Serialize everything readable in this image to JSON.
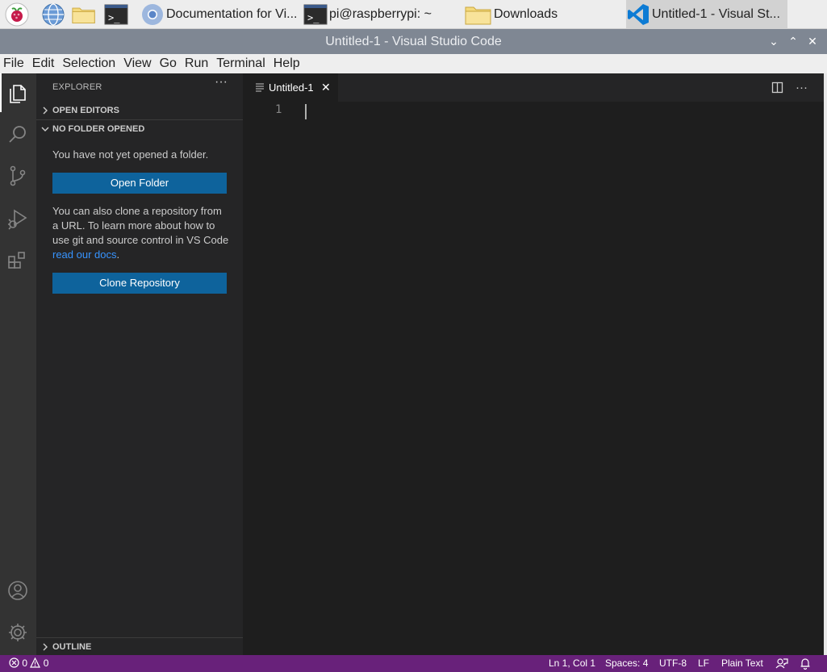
{
  "taskbar": {
    "tasks": [
      {
        "label": "Documentation for Vi...",
        "icon": "chromium-icon"
      },
      {
        "label": "pi@raspberrypi: ~",
        "icon": "terminal-icon"
      },
      {
        "label": "Downloads",
        "icon": "folder-icon"
      },
      {
        "label": "Untitled-1 - Visual St...",
        "icon": "vscode-icon"
      }
    ]
  },
  "window": {
    "title": "Untitled-1 - Visual Studio Code",
    "controls": {
      "minimize": "⌄",
      "maximize": "⌃",
      "close": "✕"
    }
  },
  "menu": [
    "File",
    "Edit",
    "Selection",
    "View",
    "Go",
    "Run",
    "Terminal",
    "Help"
  ],
  "sidebar": {
    "title": "EXPLORER",
    "more": "···",
    "open_editors": "OPEN EDITORS",
    "no_folder": "NO FOLDER OPENED",
    "no_folder_msg": "You have not yet opened a folder.",
    "open_folder_btn": "Open Folder",
    "clone_msg": "You can also clone a repository from a URL. To learn more about how to use git and source control in VS Code ",
    "clone_link": "read our docs",
    "clone_period": ".",
    "clone_btn": "Clone Repository",
    "outline": "OUTLINE"
  },
  "editor": {
    "tab_label": "Untitled-1",
    "tab_close": "✕",
    "line_numbers": [
      "1"
    ],
    "more": "···"
  },
  "status": {
    "errors": "0",
    "warnings": "0",
    "position": "Ln 1, Col 1",
    "spaces": "Spaces: 4",
    "encoding": "UTF-8",
    "eol": "LF",
    "language": "Plain Text"
  },
  "colors": {
    "status_bar": "#68217a",
    "button": "#0e639c",
    "link": "#3794ff",
    "activity_bar": "#333333",
    "sidebar": "#252526",
    "editor": "#1e1e1e"
  }
}
